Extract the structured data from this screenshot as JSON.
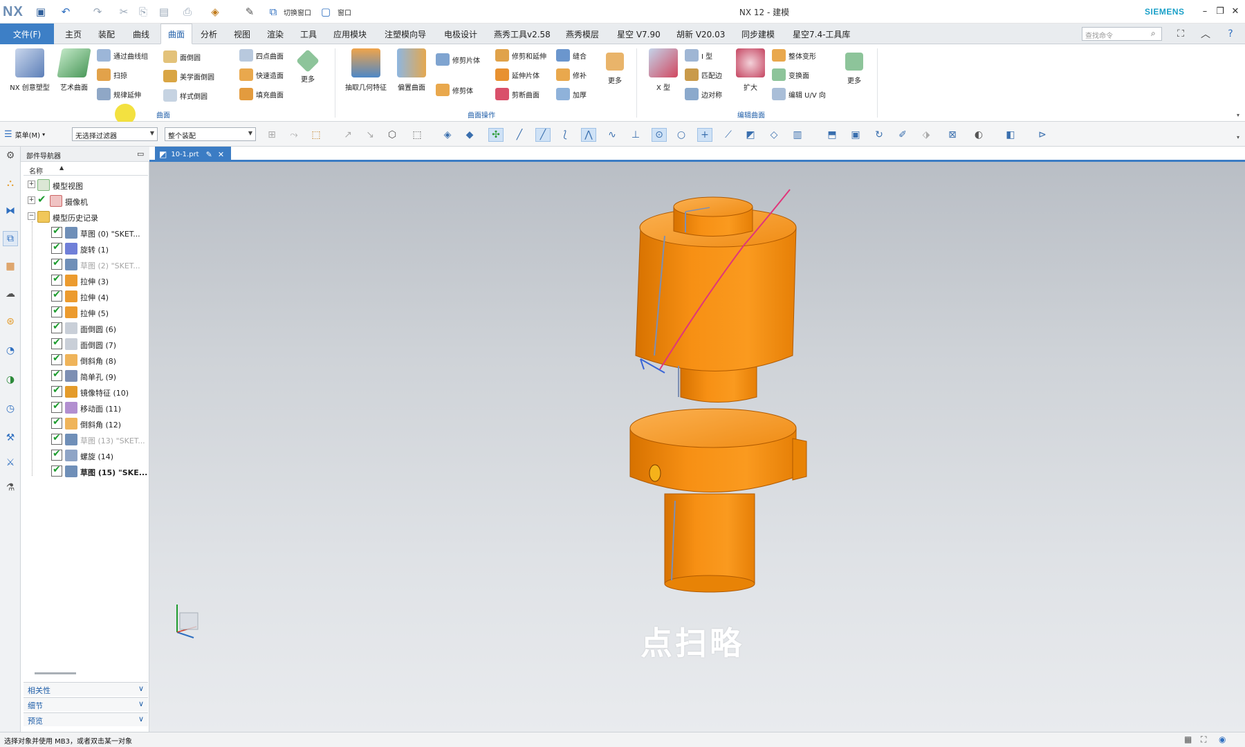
{
  "titlebar": {
    "logo": "NX",
    "switch_window_label": "切换窗口",
    "window_label": "窗口",
    "title": "NX 12 - 建模",
    "brand": "SIEMENS"
  },
  "menu": {
    "file": "文件(F)",
    "tabs": [
      "主页",
      "装配",
      "曲线",
      "曲面",
      "分析",
      "视图",
      "渲染",
      "工具",
      "应用模块",
      "注塑模向导",
      "电极设计",
      "燕秀工具v2.58",
      "燕秀模层",
      "星空 V7.90",
      "胡新 V20.03",
      "同步建模",
      "星空7.4-工具库"
    ],
    "active_tab": "曲面",
    "search_placeholder": "查找命令"
  },
  "ribbon": {
    "big_buttons": [
      "NX 创意塑型",
      "艺术曲面",
      "抽取几何特征",
      "偏置曲面",
      "X 型",
      "扩大"
    ],
    "surface_small": [
      "通过曲线组",
      "扫掠",
      "规律延伸",
      "面倒圆",
      "美学面倒圆",
      "样式倒圆",
      "四点曲面",
      "快速造面",
      "填充曲面"
    ],
    "more": "更多",
    "group_surface": "曲面",
    "op_small": [
      "修剪片体",
      "修剪体",
      "修剪和延伸",
      "延伸片体",
      "剪断曲面",
      "缝合",
      "修补",
      "加厚"
    ],
    "group_operation": "曲面操作",
    "edit_small": [
      "I 型",
      "匹配边",
      "边对称",
      "整体变形",
      "变换面",
      "编辑 U/V 向"
    ],
    "group_edit": "编辑曲面"
  },
  "selection_bar": {
    "menu_label": "菜单(M)",
    "filter": "无选择过滤器",
    "scope": "整个装配"
  },
  "navigator": {
    "title": "部件导航器",
    "col_name": "名称",
    "rows": [
      {
        "label": "模型视图",
        "type": "folder"
      },
      {
        "label": "摄像机",
        "type": "folder"
      },
      {
        "label": "模型历史记录",
        "type": "folder"
      },
      {
        "label": "草图 (0) \"SKET...",
        "type": "sketch",
        "dim": false
      },
      {
        "label": "旋转 (1)",
        "type": "revolve",
        "dim": false
      },
      {
        "label": "草图 (2) \"SKET...",
        "type": "sketch",
        "dim": true
      },
      {
        "label": "拉伸 (3)",
        "type": "extrude",
        "dim": false
      },
      {
        "label": "拉伸 (4)",
        "type": "extrude",
        "dim": false
      },
      {
        "label": "拉伸 (5)",
        "type": "extrude",
        "dim": false
      },
      {
        "label": "面倒圆 (6)",
        "type": "blend",
        "dim": false
      },
      {
        "label": "面倒圆 (7)",
        "type": "blend",
        "dim": false
      },
      {
        "label": "倒斜角 (8)",
        "type": "chamfer",
        "dim": false
      },
      {
        "label": "简单孔 (9)",
        "type": "hole",
        "dim": false
      },
      {
        "label": "镜像特征 (10)",
        "type": "mirror",
        "dim": false
      },
      {
        "label": "移动面 (11)",
        "type": "move",
        "dim": false
      },
      {
        "label": "倒斜角 (12)",
        "type": "chamfer",
        "dim": false
      },
      {
        "label": "草图 (13) \"SKET...",
        "type": "sketch",
        "dim": true
      },
      {
        "label": "螺旋 (14)",
        "type": "helix",
        "dim": false
      },
      {
        "label": "草图 (15) \"SKE...",
        "type": "sketch",
        "dim": false,
        "bold": true
      }
    ],
    "panels": [
      "相关性",
      "细节",
      "预览"
    ]
  },
  "document": {
    "tab": "10-1.prt"
  },
  "graphics": {
    "subtitle": "点扫略",
    "model_color": "#f28c0f",
    "helix_color": "#e0357a"
  },
  "status": {
    "prompt": "选择对象并使用 MB3，或者双击某一对象"
  }
}
